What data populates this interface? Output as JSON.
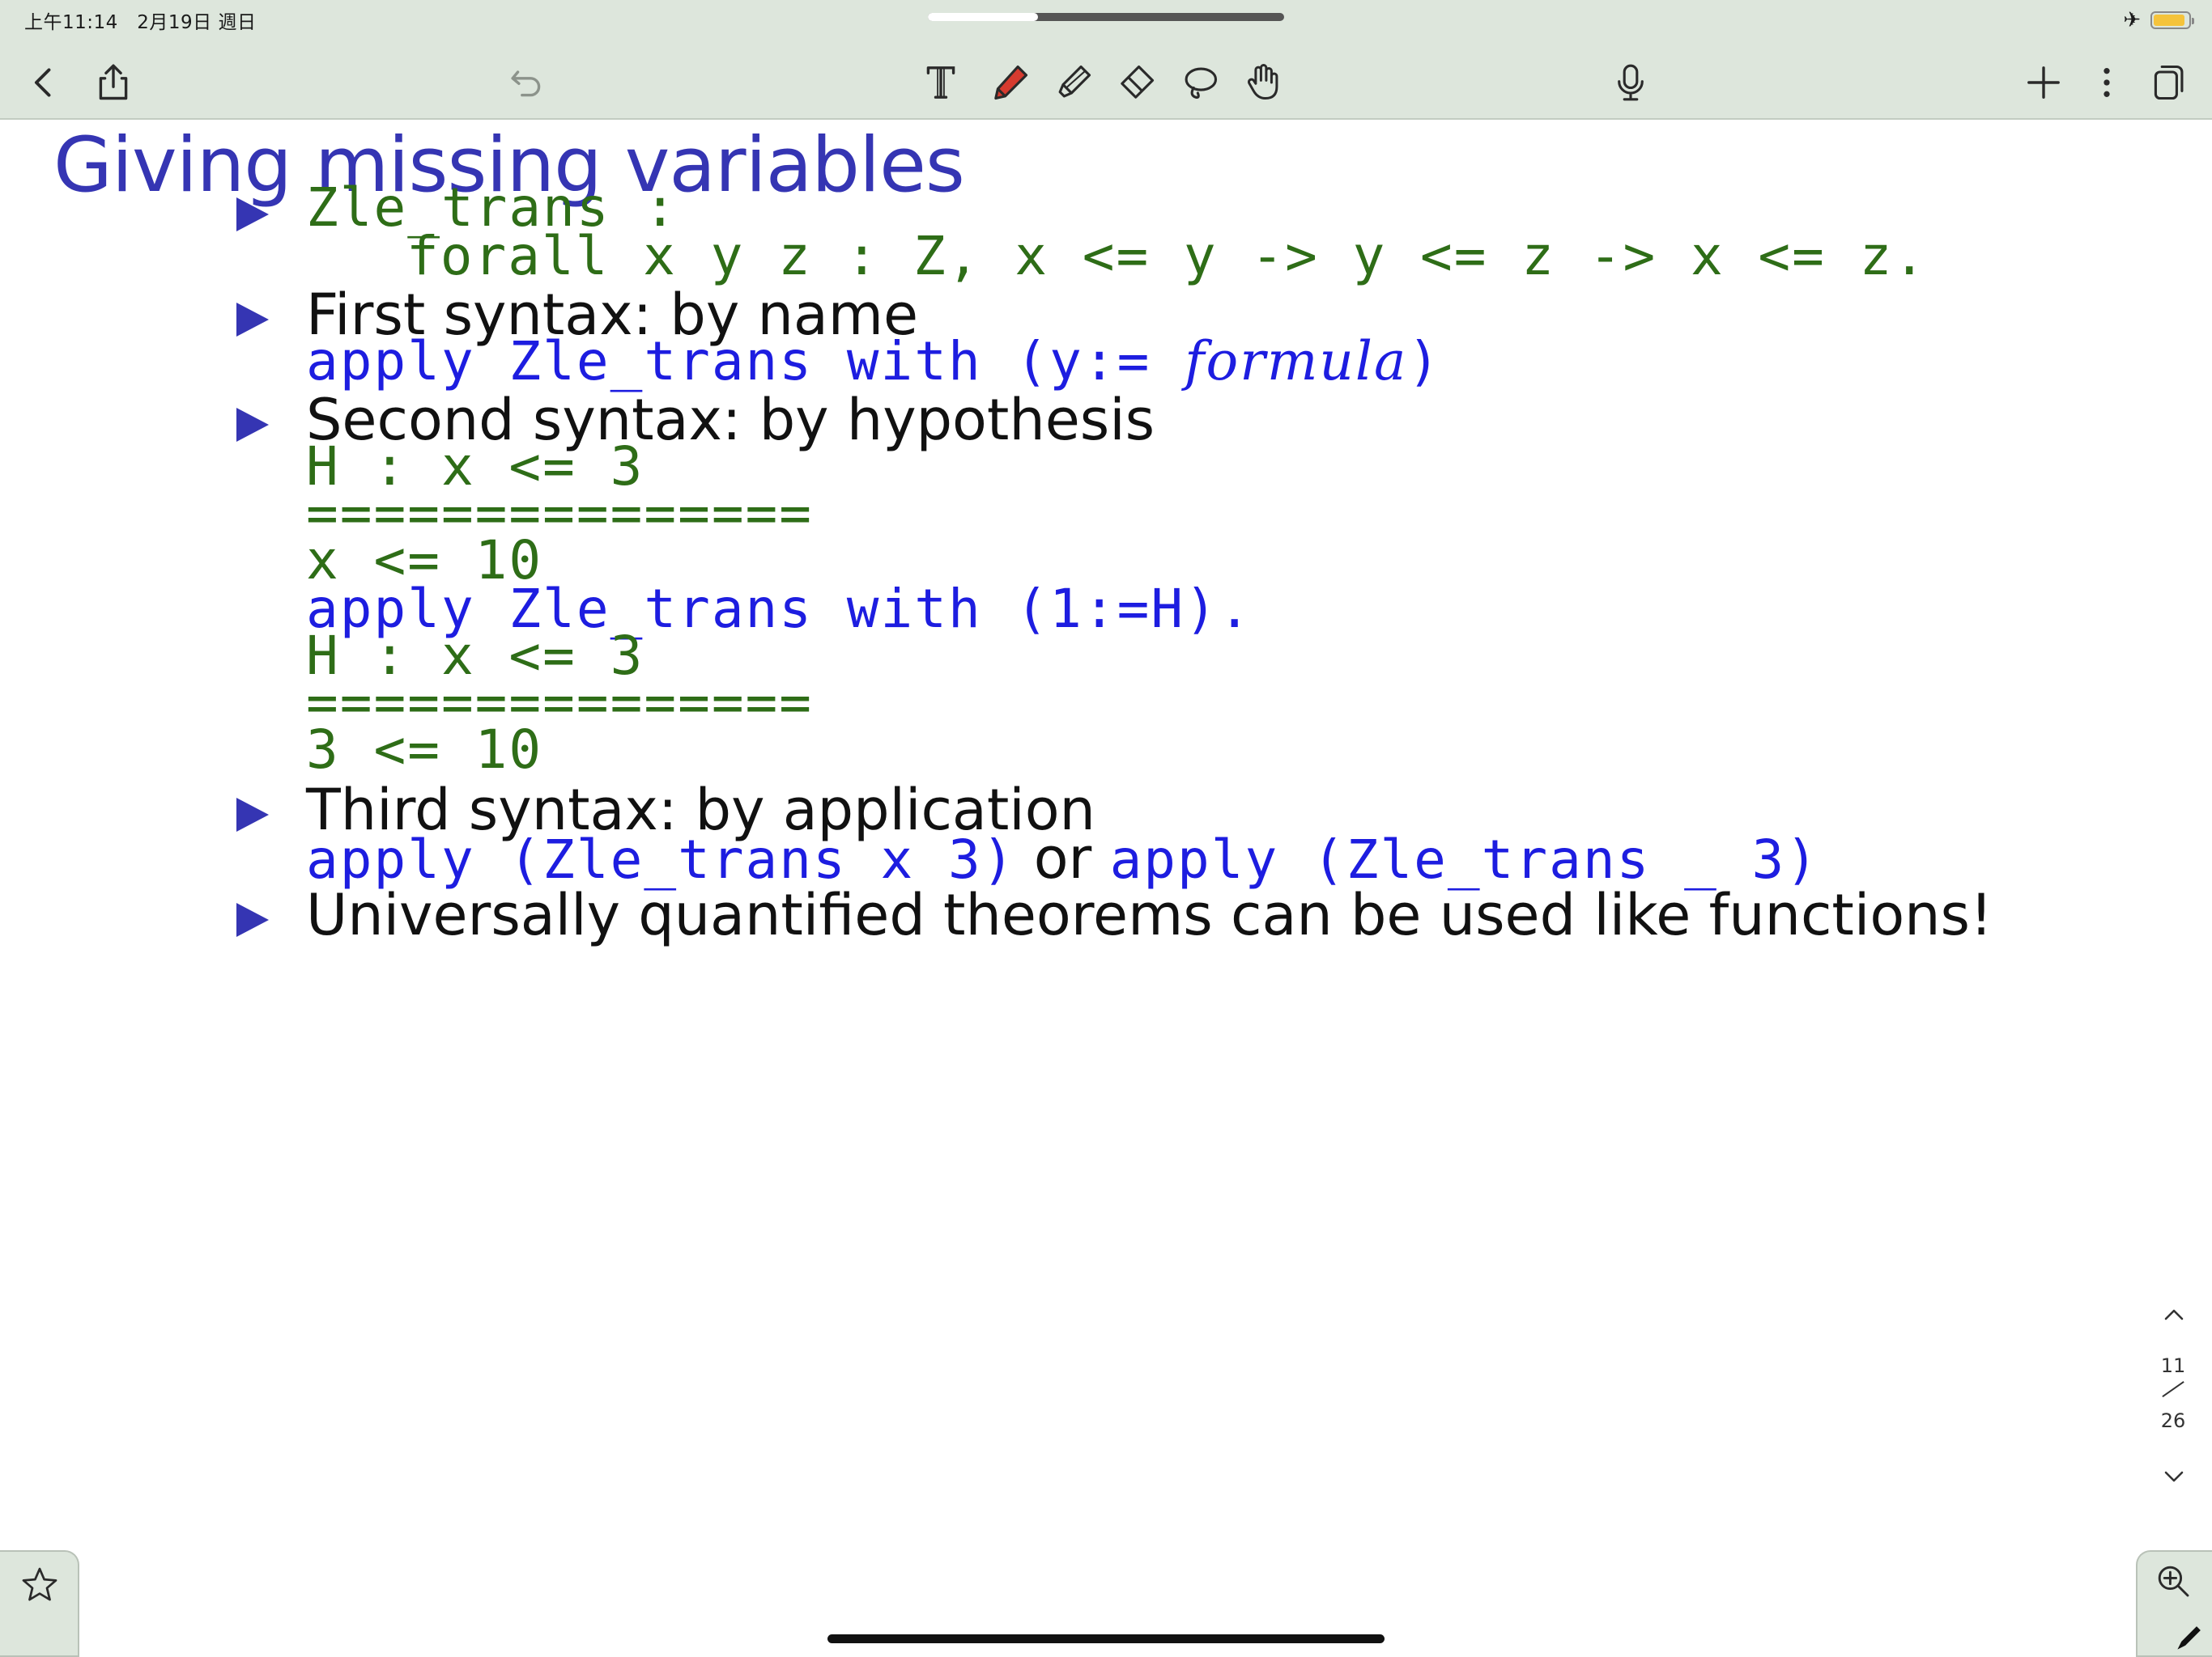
{
  "status_bar": {
    "time_date": "上午11:14　2月19日 週日"
  },
  "scrubber": {
    "progress": 0.31
  },
  "toolbar": {
    "back_icon": "chevron-left-icon",
    "share_icon": "share-icon",
    "undo_icon": "undo-icon",
    "tools": [
      "text-tool-icon",
      "pen-icon",
      "highlighter-icon",
      "eraser-icon",
      "lasso-icon",
      "hand-icon"
    ],
    "mic_icon": "microphone-icon",
    "add_icon": "plus-icon",
    "more_icon": "more-icon",
    "pages_icon": "pages-icon"
  },
  "slide": {
    "title": "Giving missing variables",
    "bullets": [
      {
        "lines": [
          [
            {
              "t": "Zle_trans :",
              "s": "code green"
            }
          ],
          [
            {
              "t": "forall x y z : Z, x <= y -> y <= z -> x <= z.",
              "s": "code green"
            }
          ]
        ]
      },
      {
        "lines": [
          [
            {
              "t": "First syntax: by name",
              "s": "txt"
            }
          ],
          [
            {
              "t": "apply Zle_trans with (y:= ",
              "s": "code blue"
            },
            {
              "t": "formula",
              "s": "code blue it"
            },
            {
              "t": ")",
              "s": "code blue"
            }
          ]
        ]
      },
      {
        "lines": [
          [
            {
              "t": "Second syntax: by hypothesis",
              "s": "txt"
            }
          ],
          [
            {
              "t": "H : x <= 3",
              "s": "code green"
            }
          ],
          [
            {
              "t": "===============",
              "s": "code green"
            }
          ],
          [
            {
              "t": "x <= 10",
              "s": "code green"
            }
          ],
          [
            {
              "t": "apply Zle_trans with (1:=H).",
              "s": "code blue"
            }
          ],
          [
            {
              "t": "H : x <= 3",
              "s": "code green"
            }
          ],
          [
            {
              "t": "===============",
              "s": "code green"
            }
          ],
          [
            {
              "t": "3 <= 10",
              "s": "code green"
            }
          ]
        ]
      },
      {
        "lines": [
          [
            {
              "t": "Third syntax: by application",
              "s": "txt"
            }
          ],
          [
            {
              "t": "apply (Zle_trans x 3)",
              "s": "code blue"
            },
            {
              "t": " or ",
              "s": "txt"
            },
            {
              "t": "apply (Zle_trans _ 3)",
              "s": "code blue"
            }
          ]
        ]
      },
      {
        "lines": [
          [
            {
              "t": "Universally quantified theorems can be used like functions!",
              "s": "txt"
            }
          ]
        ]
      }
    ]
  },
  "pager": {
    "current": "11",
    "total": "26"
  },
  "corners": {
    "favorite_icon": "star-icon",
    "zoom_icon": "zoom-in-icon",
    "pen_icon": "pencil-icon"
  },
  "colors": {
    "chrome_bg": "#dde6dc",
    "title_blue": "#3535b3",
    "code_green": "#2e6d17",
    "code_blue": "#1d1de0"
  }
}
